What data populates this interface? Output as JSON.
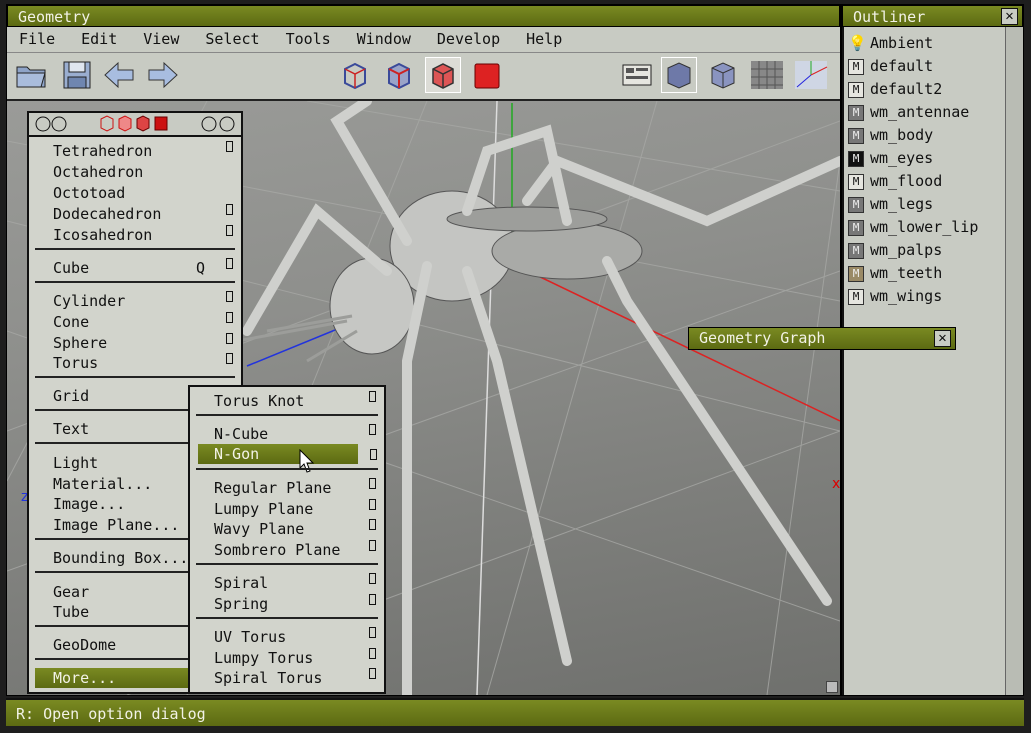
{
  "window": {
    "title": "Geometry"
  },
  "menubar": [
    "File",
    "Edit",
    "View",
    "Select",
    "Tools",
    "Window",
    "Develop",
    "Help"
  ],
  "outliner": {
    "title": "Outliner",
    "items": [
      {
        "icon": "bulb",
        "label": "Ambient"
      },
      {
        "icon": "M",
        "label": "default"
      },
      {
        "icon": "M",
        "label": "default2"
      },
      {
        "icon": "M-dark",
        "label": "wm_antennae"
      },
      {
        "icon": "M-dark",
        "label": "wm_body"
      },
      {
        "icon": "M-black",
        "label": "wm_eyes"
      },
      {
        "icon": "M",
        "label": "wm_flood"
      },
      {
        "icon": "M-dark",
        "label": "wm_legs"
      },
      {
        "icon": "M-dark",
        "label": "wm_lower_lip"
      },
      {
        "icon": "M-dark",
        "label": "wm_palps"
      },
      {
        "icon": "M-tan",
        "label": "wm_teeth"
      },
      {
        "icon": "M",
        "label": "wm_wings"
      }
    ]
  },
  "graph_panel": {
    "title": "Geometry Graph"
  },
  "primitives_menu": {
    "items": [
      {
        "label": "Tetrahedron",
        "opt": true
      },
      {
        "label": "Octahedron",
        "opt": false
      },
      {
        "label": "Octotoad",
        "opt": false
      },
      {
        "label": "Dodecahedron",
        "opt": true
      },
      {
        "label": "Icosahedron",
        "opt": true
      },
      {
        "label": "Cube",
        "shortcut": "Q",
        "opt": true
      },
      {
        "label": "Cylinder",
        "opt": true
      },
      {
        "label": "Cone",
        "opt": true
      },
      {
        "label": "Sphere",
        "opt": true
      },
      {
        "label": "Torus",
        "opt": true
      },
      {
        "label": "Grid",
        "opt": false
      },
      {
        "label": "Text",
        "opt": false
      },
      {
        "label": "Light",
        "opt": false
      },
      {
        "label": "Material...",
        "opt": false
      },
      {
        "label": "Image...",
        "opt": false
      },
      {
        "label": "Image Plane...",
        "opt": false
      },
      {
        "label": "Bounding Box...",
        "opt": false
      },
      {
        "label": "Gear",
        "opt": false
      },
      {
        "label": "Tube",
        "opt": false
      },
      {
        "label": "GeoDome",
        "opt": false
      },
      {
        "label": "More...",
        "opt": false,
        "highlighted": true
      }
    ]
  },
  "more_menu": {
    "items": [
      {
        "label": "Torus Knot"
      },
      {
        "label": "N-Cube"
      },
      {
        "label": "N-Gon",
        "highlighted": true
      },
      {
        "label": "Regular Plane"
      },
      {
        "label": "Lumpy Plane"
      },
      {
        "label": "Wavy Plane"
      },
      {
        "label": "Sombrero Plane"
      },
      {
        "label": "Spiral"
      },
      {
        "label": "Spring"
      },
      {
        "label": "UV Torus"
      },
      {
        "label": "Lumpy Torus"
      },
      {
        "label": "Spiral Torus"
      }
    ]
  },
  "status": {
    "text": "R: Open option dialog"
  },
  "colors": {
    "accent": "#6b7a1a",
    "panel": "#c8cbc3",
    "highlight": "#5c6a12"
  }
}
